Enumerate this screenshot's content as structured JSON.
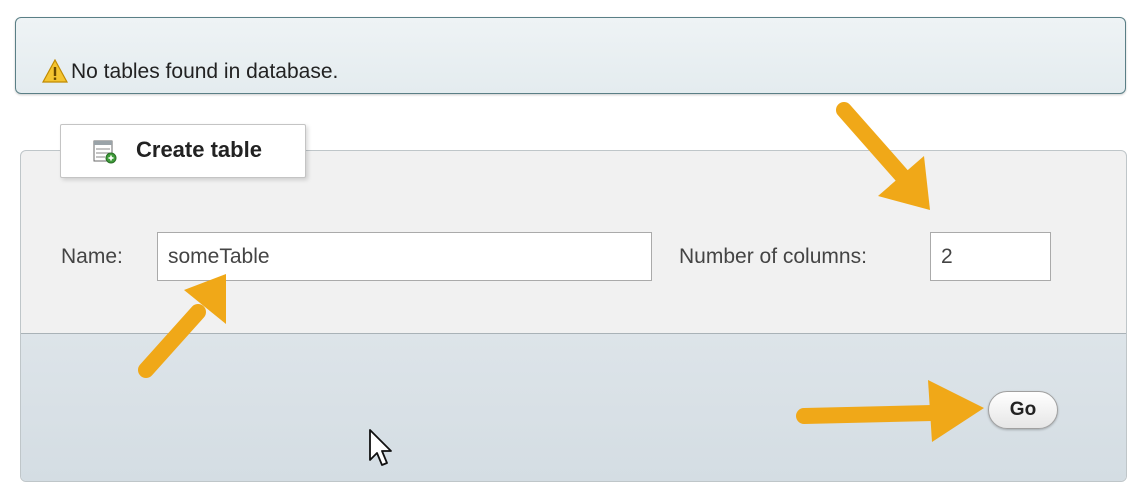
{
  "notice": {
    "icon": "warning-icon",
    "text": "No tables found in database."
  },
  "create_table": {
    "icon": "table-add-icon",
    "legend": "Create table",
    "name_label": "Name:",
    "name_value": "someTable",
    "columns_label": "Number of columns:",
    "columns_value": "2",
    "go_label": "Go"
  },
  "colors": {
    "annotation_arrow": "#f0a818",
    "warning": "#f4c430"
  }
}
